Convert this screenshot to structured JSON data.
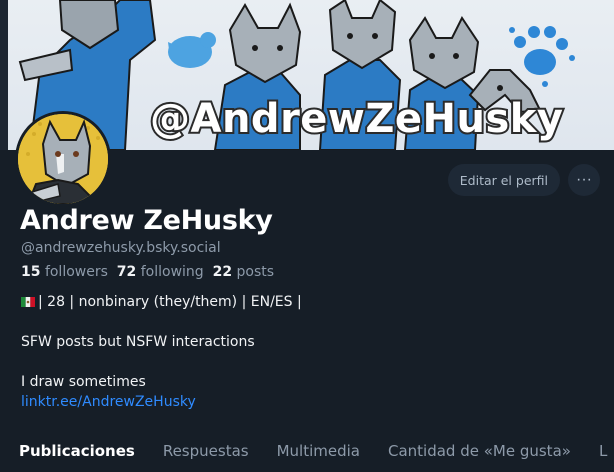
{
  "banner": {
    "handle_text": "@AndrewZeHusky"
  },
  "profile": {
    "display_name": "Andrew ZeHusky",
    "handle": "@andrewzehusky.bsky.social",
    "stats": {
      "followers_count": "15",
      "followers_label": "followers",
      "following_count": "72",
      "following_label": "following",
      "posts_count": "22",
      "posts_label": "posts"
    },
    "bio": {
      "line1": "| 28 | nonbinary (they/them) | EN/ES |",
      "line2": "SFW posts but NSFW interactions",
      "line3": "I draw sometimes",
      "link": "linktr.ee/AndrewZeHusky"
    }
  },
  "actions": {
    "edit_label": "Editar el perfil",
    "more_label": "···"
  },
  "tabs": [
    {
      "label": "Publicaciones"
    },
    {
      "label": "Respuestas"
    },
    {
      "label": "Multimedia"
    },
    {
      "label": "Cantidad de «Me gusta»"
    },
    {
      "label": "L"
    }
  ],
  "colors": {
    "background": "#161e27",
    "link": "#2f8bff",
    "banner_blue": "#2f86cf",
    "avatar_yellow": "#e8c23a"
  },
  "icons": [
    "facebook-logo-icon",
    "twitter-bird-icon",
    "tumblr-logo-icon",
    "paw-print-icon",
    "flag-mexico-icon",
    "more-options-icon"
  ]
}
